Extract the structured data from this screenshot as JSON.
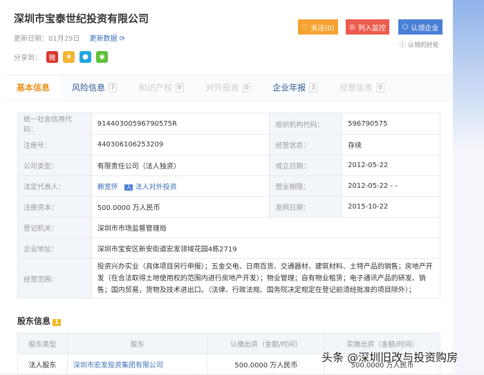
{
  "company": {
    "name": "深圳市宝泰世纪投资有限公司",
    "update_label": "更新日期：01月29日",
    "refresh": "更新数据",
    "share_label": "分享到："
  },
  "buttons": {
    "follow": "关注(0)",
    "monitor": "列入监控",
    "claim": "认领企业",
    "help": "认领的好处"
  },
  "tabs": [
    {
      "label": "基本信息"
    },
    {
      "label": "风险信息",
      "count": "7"
    },
    {
      "label": "知识产权",
      "count": "0"
    },
    {
      "label": "对外投资",
      "count": "0"
    },
    {
      "label": "企业年报",
      "count": "3"
    },
    {
      "label": "经营信息",
      "count": "0"
    }
  ],
  "info": {
    "credit_code_l": "统一社会信用代码：",
    "credit_code": "91440300596790575R",
    "org_code_l": "组织机构代码：",
    "org_code": "596790575",
    "reg_no_l": "注册号：",
    "reg_no": "440306106253209",
    "status_l": "经营状态：",
    "status": "存续",
    "type_l": "公司类型：",
    "type": "有限责任公司（法人独资）",
    "found_l": "成立日期：",
    "found": "2012-05-22",
    "rep_l": "法定代表人：",
    "rep": "赖宽怀",
    "rep_link": "法人对外投资",
    "term_l": "营业期限：",
    "term": "2012-05-22 - -",
    "capital_l": "注册资本：",
    "capital": "500.0000 万人民币",
    "issue_l": "发照日期：",
    "issue": "2015-10-22",
    "authority_l": "登记机关：",
    "authority": "深圳市市场监督管理局",
    "addr_l": "企业地址：",
    "addr": "深圳市宝安区新安街道宏发领域花园4栋2719",
    "scope_l": "经营范围：",
    "scope": "投资兴办实业（具体项目另行申报）；五金交电、日用百货、交通器材、建筑材料、土特产品的销售；房地产开发（在合法取得土地使用权的范围内进行房地产开发）；物业管理；自有物业租赁；电子通讯产品的研发、销售；国内贸易，货物及技术进出口。（法律、行政法规、国务院决定规定在登记前须经批准的项目除外）；"
  },
  "shareholders": {
    "title": "股东信息",
    "count": "1",
    "headers": [
      "股东类型",
      "股东",
      "认缴出资（金额/时间）",
      "实缴出资（金额/时间）"
    ],
    "rows": [
      {
        "type": "法人股东",
        "name": "深圳市宏发投资集团有限公司",
        "sub": "500.0000 万人民币",
        "paid": "500.0000 万人民币"
      }
    ]
  },
  "watermark": "头条 @深圳旧改与投资购房"
}
